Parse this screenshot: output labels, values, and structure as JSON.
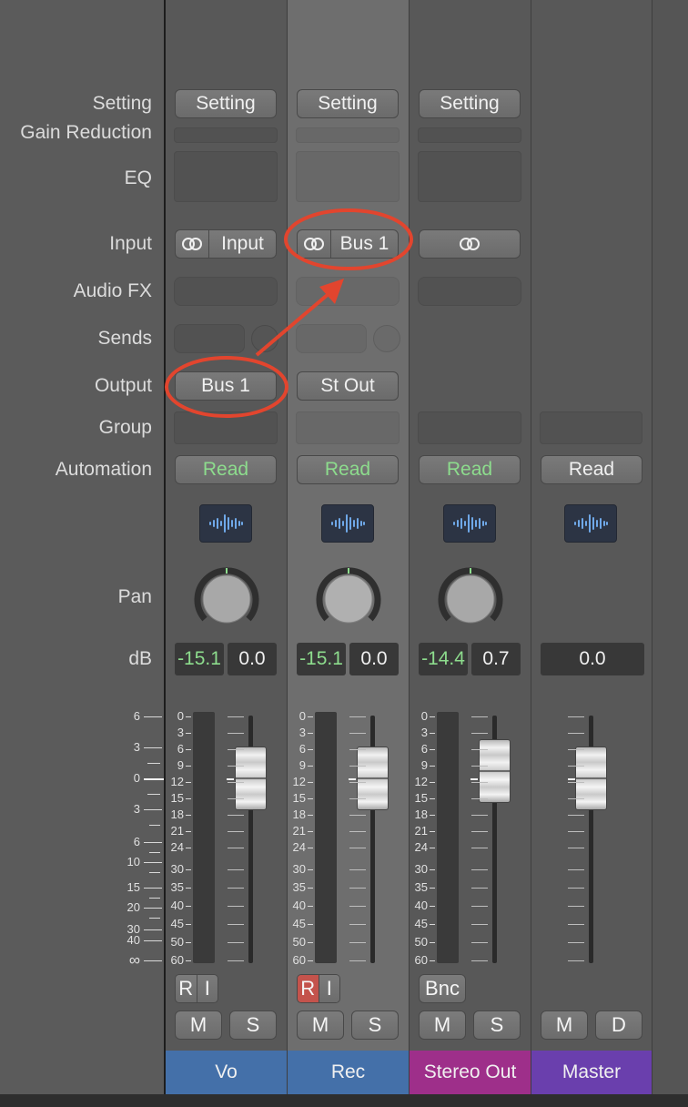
{
  "row_labels": {
    "setting": "Setting",
    "gain_reduction": "Gain Reduction",
    "eq": "EQ",
    "input": "Input",
    "audio_fx": "Audio FX",
    "sends": "Sends",
    "output": "Output",
    "group": "Group",
    "automation": "Automation",
    "pan": "Pan",
    "db": "dB"
  },
  "left_scale": [
    "6",
    "3",
    "0",
    "3",
    "6",
    "10",
    "15",
    "20",
    "30",
    "40",
    "∞"
  ],
  "meter_scale": [
    "0",
    "3",
    "6",
    "9",
    "12",
    "15",
    "18",
    "21",
    "24",
    "30",
    "35",
    "40",
    "45",
    "50",
    "60"
  ],
  "channels": [
    {
      "name": "Vo",
      "name_color": "#4470a9",
      "setting": "Setting",
      "input": "Input",
      "output": "Bus 1",
      "automation": "Read",
      "peak_db": "-15.1",
      "fader_db": "0.0",
      "record_label": "R",
      "input_monitor_label": "I",
      "mute_label": "M",
      "solo_label": "S"
    },
    {
      "name": "Rec",
      "name_color": "#4470a9",
      "setting": "Setting",
      "input": "Bus 1",
      "output": "St Out",
      "automation": "Read",
      "peak_db": "-15.1",
      "fader_db": "0.0",
      "record_label": "R",
      "input_monitor_label": "I",
      "mute_label": "M",
      "solo_label": "S"
    },
    {
      "name": "Stereo Out",
      "name_color": "#9e2f8a",
      "setting": "Setting",
      "automation": "Read",
      "peak_db": "-14.4",
      "fader_db": "0.7",
      "bounce_label": "Bnc",
      "mute_label": "M",
      "solo_label": "S"
    },
    {
      "name": "Master",
      "name_color": "#6a3fad",
      "automation": "Read",
      "fader_db": "0.0",
      "mute_label": "M",
      "dim_label": "D"
    }
  ],
  "colors": {
    "automation_read": "#8ddc8d",
    "record_enabled": "#c4534c",
    "annotation": "#e2452e",
    "meter_display_text": "#f0f0f0"
  }
}
